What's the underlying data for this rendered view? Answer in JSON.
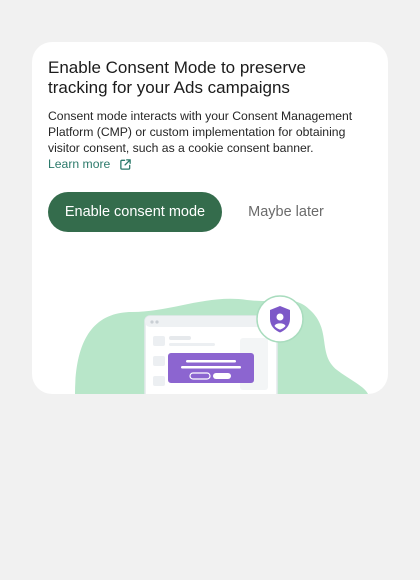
{
  "dialog": {
    "title": "Enable Consent Mode to preserve tracking for your Ads campaigns",
    "description": "Consent mode interacts with your Consent Management Platform (CMP) or custom implementation for obtaining visitor consent, such as a cookie consent banner.",
    "learn_more_label": "Learn more",
    "learn_more_icon": "external-link-icon",
    "primary_button_label": "Enable consent mode",
    "secondary_button_label": "Maybe later"
  },
  "colors": {
    "page_background": "#f1f1f1",
    "card_background": "#ffffff",
    "primary_button": "#346c4c",
    "link": "#2c7a6b",
    "blob": "#b8e6c9",
    "accent_purple": "#8c65d0"
  },
  "illustration": {
    "icon": "shield-user-icon",
    "depicts": "browser window with consent banner"
  }
}
